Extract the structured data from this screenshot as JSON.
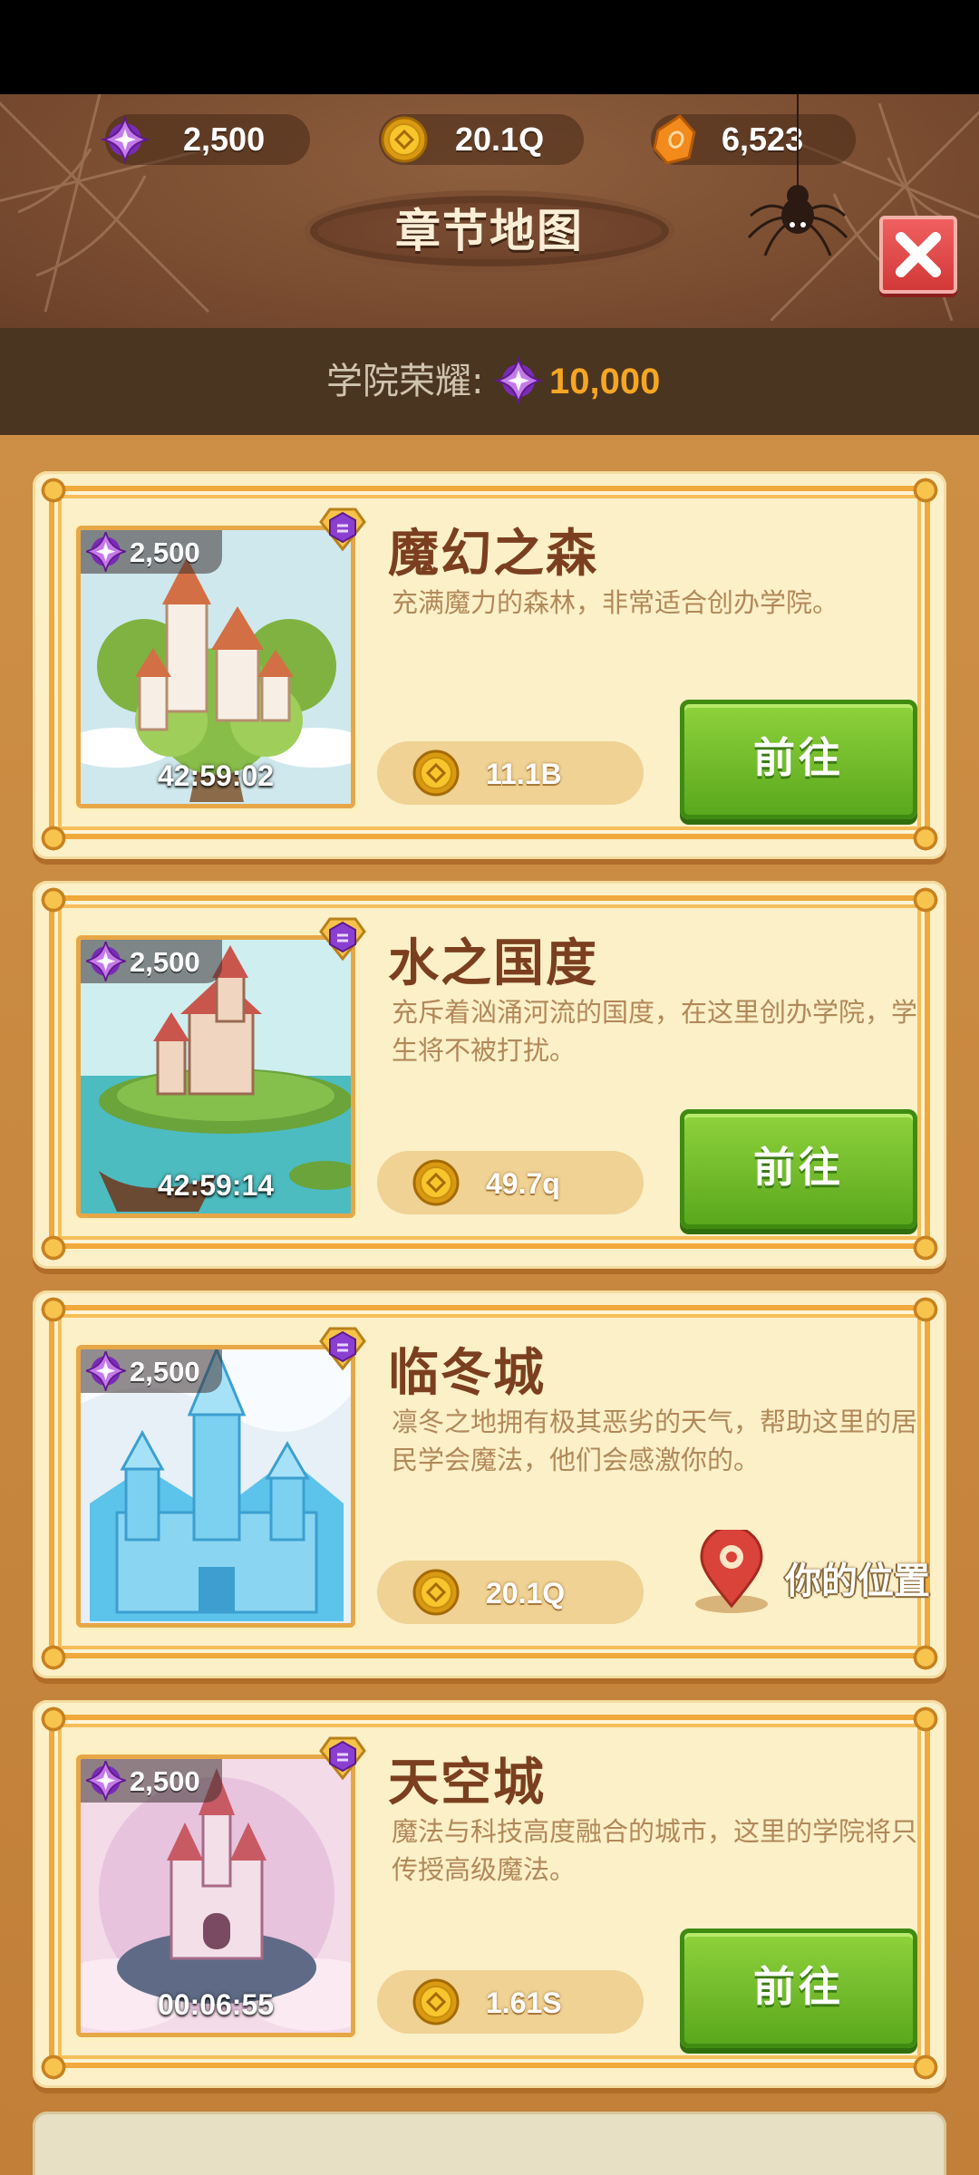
{
  "resources": {
    "gems": "2,500",
    "coins": "20.1Q",
    "crystals": "6,523"
  },
  "header": {
    "title": "章节地图"
  },
  "honor": {
    "label": "学院荣耀:",
    "value": "10,000"
  },
  "chapters": [
    {
      "title": "魔幻之森",
      "description": "充满魔力的森林，非常适合创办学院。",
      "gems": "2,500",
      "timer": "42:59:02",
      "cost": "11.1B",
      "action": "前往",
      "theme": "forest"
    },
    {
      "title": "水之国度",
      "description": "充斥着汹涌河流的国度，在这里创办学院，学生将不被打扰。",
      "gems": "2,500",
      "timer": "42:59:14",
      "cost": "49.7q",
      "action": "前往",
      "theme": "water"
    },
    {
      "title": "临冬城",
      "description": "凛冬之地拥有极其恶劣的天气，帮助这里的居民学会魔法，他们会感激你的。",
      "gems": "2,500",
      "timer": "",
      "cost": "20.1Q",
      "location_label": "你的位置",
      "theme": "ice"
    },
    {
      "title": "天空城",
      "description": "魔法与科技高度融合的城市，这里的学院将只传授高级魔法。",
      "gems": "2,500",
      "timer": "00:06:55",
      "cost": "1.61S",
      "action": "前往",
      "theme": "sky"
    }
  ],
  "colors": {
    "accent_green": "#6bb82a",
    "close_red": "#e04848",
    "title_brown": "#7b3f1f",
    "honor_orange": "#f6a623"
  },
  "icons": [
    "purple-gem-icon",
    "gold-coin-icon",
    "orange-crystal-icon",
    "close-icon",
    "location-pin-icon",
    "chapter-badge-icon"
  ]
}
